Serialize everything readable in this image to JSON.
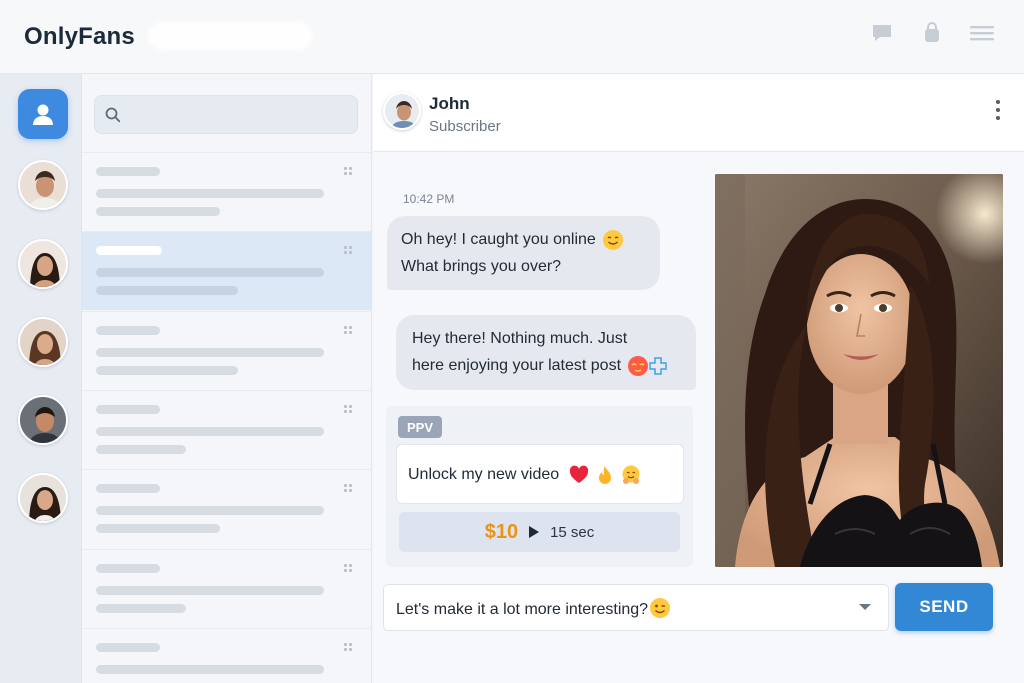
{
  "app": {
    "brand": "OnlyFans"
  },
  "header": {
    "icons": [
      "chat-icon",
      "bag-icon",
      "menu-icon"
    ]
  },
  "rail": {
    "profile_icon": "user-icon",
    "avatars": [
      "contact-1",
      "contact-2",
      "contact-3",
      "contact-4",
      "contact-5"
    ]
  },
  "search": {
    "placeholder": "",
    "value": ""
  },
  "conversations": {
    "active_index": 1,
    "count": 7
  },
  "chat": {
    "contact_name": "John",
    "contact_status": "Subscriber",
    "timestamp": "10:42 PM",
    "messages": [
      {
        "direction": "incoming",
        "line1": "Oh hey! I caught you online",
        "line2": "What brings you over?",
        "emoji": "smiling-face"
      },
      {
        "direction": "outgoing",
        "line1": "Hey there! Nothing much. Just",
        "line2": "here enjoying your latest post",
        "emoji": "kiss-face, sparkle"
      }
    ],
    "ppv": {
      "badge": "PPV",
      "message": "Unlock my new video",
      "emojis": [
        "heart",
        "fire",
        "hug-face"
      ],
      "price": "$10",
      "duration": "15 sec"
    },
    "composer": {
      "value": "Let's make it a lot more interesting?",
      "emoji": "winking-face"
    },
    "send_label": "SEND"
  },
  "colors": {
    "accent": "#3388d6",
    "price": "#e89418",
    "active_row": "#dce8f6"
  }
}
